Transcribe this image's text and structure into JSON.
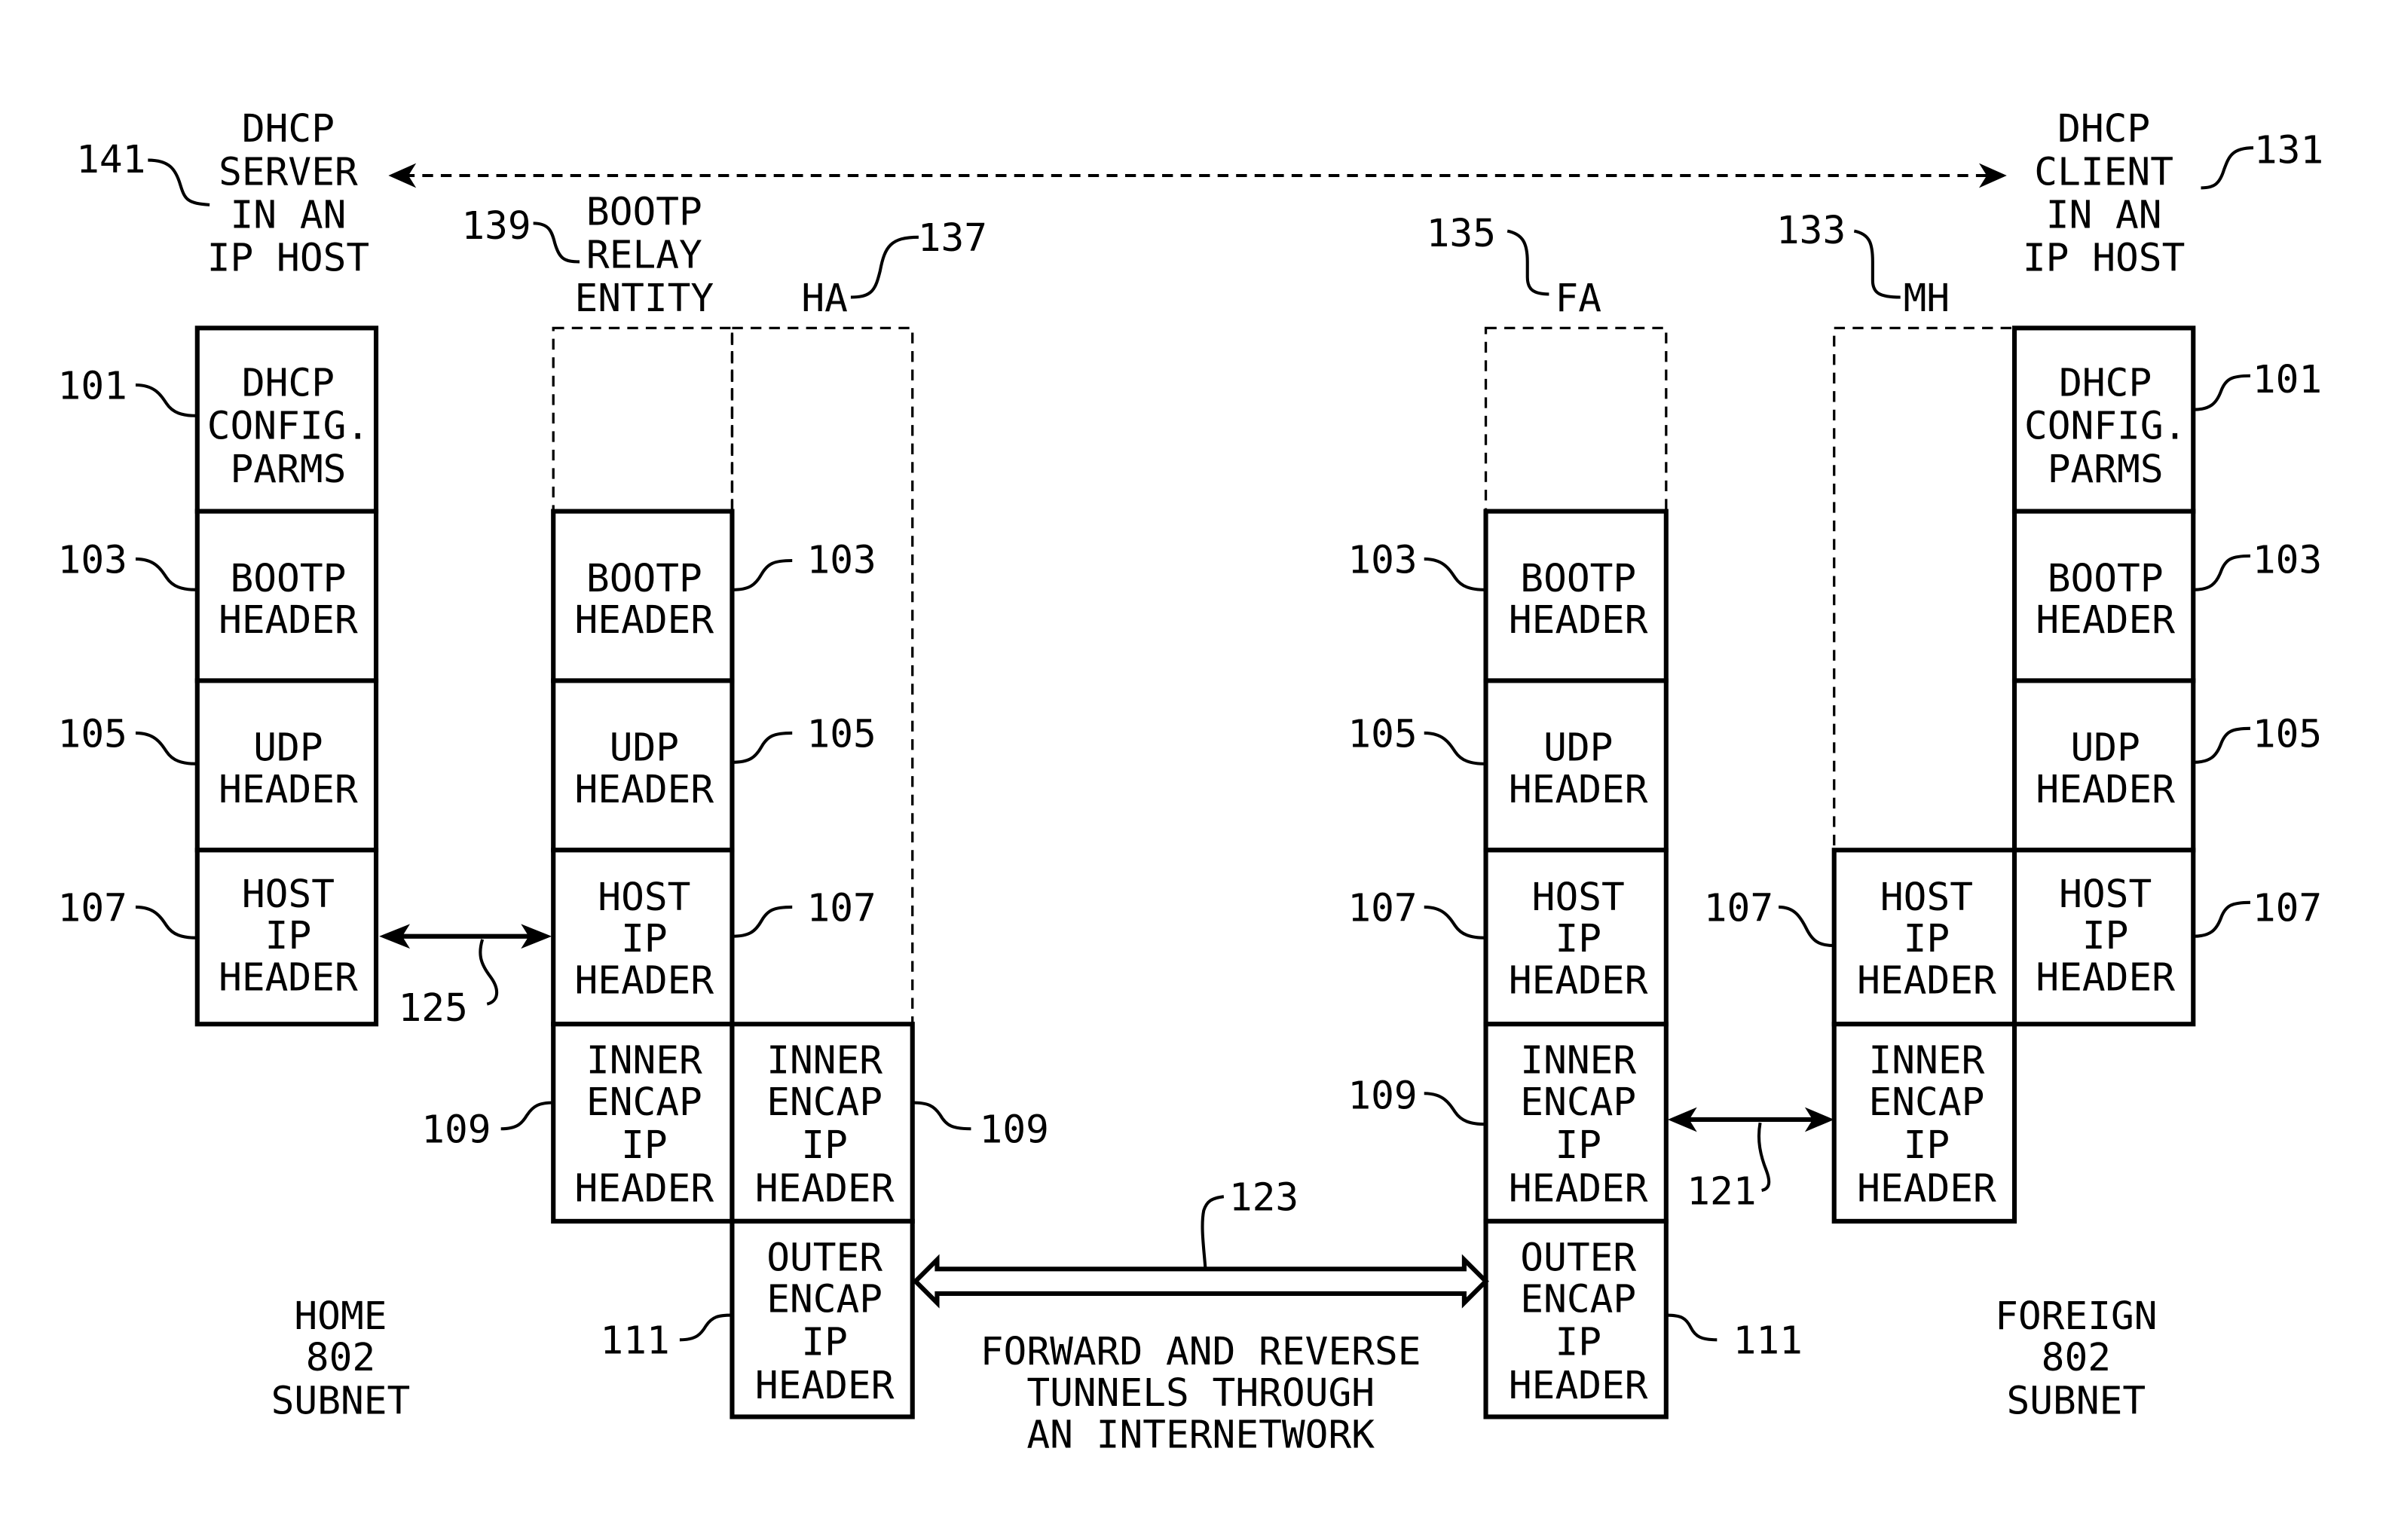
{
  "figure": {
    "entities": {
      "server": {
        "ref": "141",
        "lines": [
          "DHCP",
          "SERVER",
          "IN AN",
          "IP HOST"
        ]
      },
      "client": {
        "ref": "131",
        "lines": [
          "DHCP",
          "CLIENT",
          "IN AN",
          "IP HOST"
        ]
      },
      "relay": {
        "ref": "139",
        "lines": [
          "BOOTP",
          "RELAY",
          "ENTITY"
        ]
      },
      "ha": {
        "ref": "137",
        "label": "HA"
      },
      "fa": {
        "ref": "135",
        "label": "FA"
      },
      "mh": {
        "ref": "133",
        "label": "MH"
      }
    },
    "blocks": {
      "dhcp_config": {
        "ref": "101",
        "lines": [
          "DHCP",
          "CONFIG.",
          "PARMS"
        ]
      },
      "bootp_header": {
        "ref": "103",
        "lines": [
          "BOOTP",
          "HEADER"
        ]
      },
      "udp_header": {
        "ref": "105",
        "lines": [
          "UDP",
          "HEADER"
        ]
      },
      "host_ip_header": {
        "ref": "107",
        "lines": [
          "HOST",
          "IP",
          "HEADER"
        ]
      },
      "inner_encap": {
        "ref": "109",
        "lines": [
          "INNER",
          "ENCAP",
          "IP",
          "HEADER"
        ]
      },
      "outer_encap": {
        "ref": "111",
        "lines": [
          "OUTER",
          "ENCAP",
          "IP",
          "HEADER"
        ]
      }
    },
    "links": {
      "server_relay": {
        "ref": "125"
      },
      "tunnel": {
        "ref": "123",
        "lines": [
          "FORWARD AND REVERSE",
          "TUNNELS THROUGH",
          "AN INTERNETWORK"
        ]
      },
      "fa_mh": {
        "ref": "121"
      }
    },
    "subnets": {
      "home": {
        "lines": [
          "HOME",
          "802",
          "SUBNET"
        ]
      },
      "foreign": {
        "lines": [
          "FOREIGN",
          "802",
          "SUBNET"
        ]
      }
    }
  }
}
